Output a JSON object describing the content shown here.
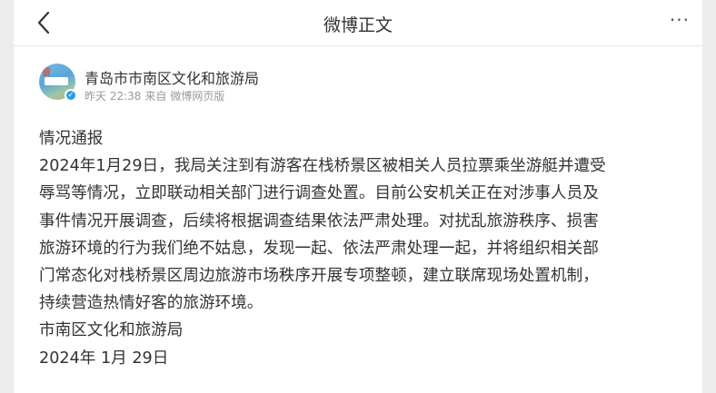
{
  "header": {
    "title": "微博正文",
    "back_icon": "chevron-left-icon",
    "more_label": "···"
  },
  "author": {
    "name": "青岛市市南区文化和旅游局",
    "verified_icon": "verified-check-icon",
    "time": "昨天 22:38",
    "source_prefix": "来自",
    "source": "微博网页版"
  },
  "post": {
    "lines": [
      "情况通报",
      "2024年1月29日，我局关注到有游客在栈桥景区被相关人员拉票乘坐游艇并遭受",
      "辱骂等情况，立即联动相关部门进行调查处置。目前公安机关正在对涉事人员及",
      "事件情况开展调查，后续将根据调查结果依法严肃处理。对扰乱旅游秩序、损害",
      "旅游环境的行为我们绝不姑息，发现一起、依法严肃处理一起，并将组织相关部",
      "门常态化对栈桥景区周边旅游市场秩序开展专项整顿，建立联席现场处置机制，",
      "持续营造热情好客的旅游环境。",
      "市南区文化和旅游局",
      "2024年 1月 29日"
    ]
  },
  "colors": {
    "text": "#333333",
    "meta": "#999999",
    "verified": "#2b9ae6"
  }
}
